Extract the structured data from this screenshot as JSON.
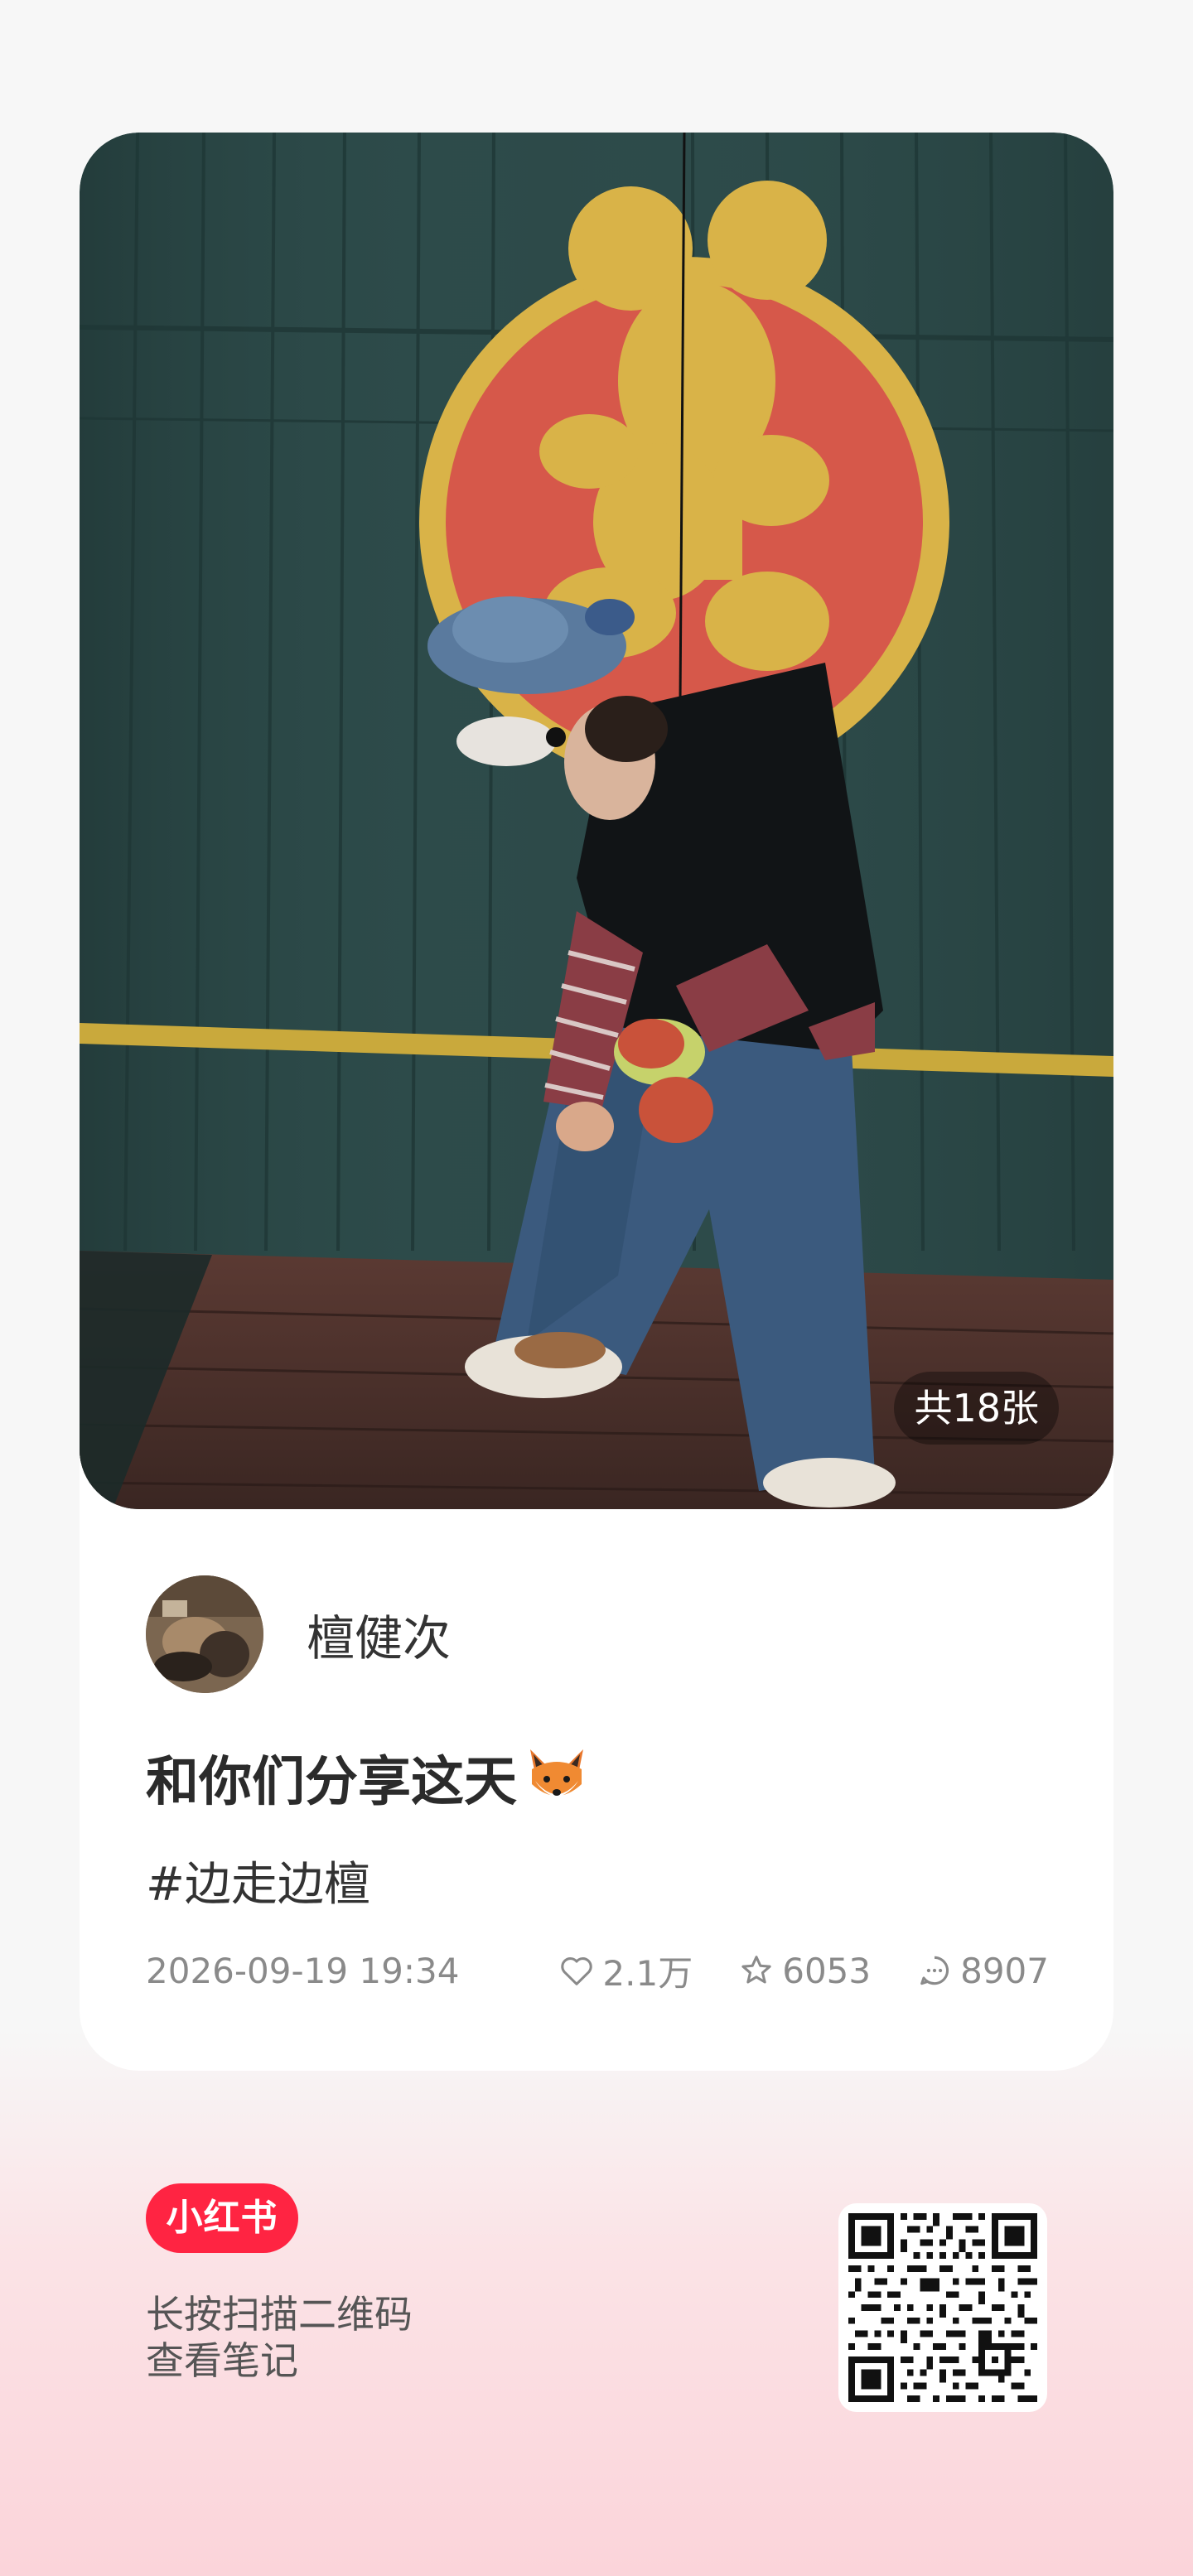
{
  "photo": {
    "count_label": "共18张"
  },
  "author": {
    "name": "檀健次"
  },
  "note": {
    "title": "和你们分享这天",
    "title_emoji": "fox-emoji",
    "tag": "#边走边檀"
  },
  "meta": {
    "date": "2026-09-19 19:34",
    "likes": "2.1万",
    "collects": "6053",
    "comments": "8907"
  },
  "footer": {
    "logo_text": "小红书",
    "scan_line1": "长按扫描二维码",
    "scan_line2": "查看笔记"
  },
  "colors": {
    "brand_red": "#ff2442",
    "photo_wall": "#2f4c4b",
    "emblem_red": "#d6584a",
    "emblem_gold": "#d9b348"
  },
  "icons": {
    "like": "heart-icon",
    "collect": "star-icon",
    "comment": "comment-icon"
  }
}
